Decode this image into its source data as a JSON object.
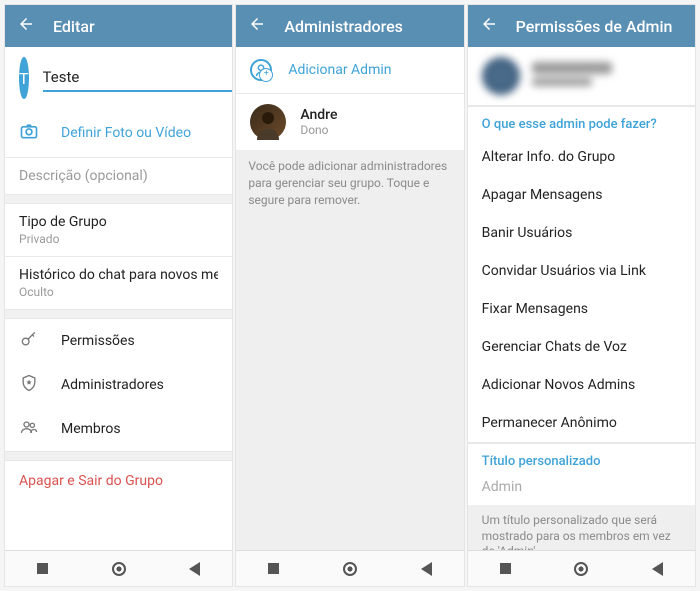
{
  "screen1": {
    "header": "Editar",
    "avatarLetter": "T",
    "nameValue": "Teste",
    "photoAction": "Definir Foto ou Vídeo",
    "descriptionPlaceholder": "Descrição (opcional)",
    "groupTypeLabel": "Tipo de Grupo",
    "groupTypeValue": "Privado",
    "historyLabel": "Histórico do chat para novos membros",
    "historyValue": "Oculto",
    "permissions": "Permissões",
    "admins": "Administradores",
    "members": "Membros",
    "leave": "Apagar e Sair do Grupo"
  },
  "screen2": {
    "header": "Administradores",
    "addAdmin": "Adicionar Admin",
    "adminName": "Andre",
    "adminRole": "Dono",
    "helpText": "Você pode adicionar administradores para gerenciar seu grupo. Toque e segure para remover."
  },
  "screen3": {
    "header": "Permissões de Admin",
    "sectionTitle": "O que esse admin pode fazer?",
    "perms": [
      "Alterar Info. do Grupo",
      "Apagar Mensagens",
      "Banir Usuários",
      "Convidar Usuários via Link",
      "Fixar Mensagens",
      "Gerenciar Chats de Voz",
      "Adicionar Novos Admins",
      "Permanecer Anônimo"
    ],
    "customTitleLabel": "Título personalizado",
    "customTitlePlaceholder": "Admin",
    "footnote": "Um título personalizado que será mostrado para os membros em vez de 'Admin'."
  }
}
